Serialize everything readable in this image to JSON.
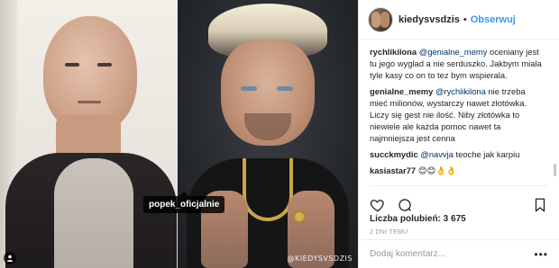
{
  "media": {
    "tag_label": "popek_oficjalnie",
    "watermark": "@KIEDYSVSDZIS"
  },
  "header": {
    "username": "kiedysvsdzis",
    "separator": "•",
    "follow_label": "Obserwuj"
  },
  "comments": [
    {
      "user": "rychlikilona",
      "mention": "@genialne_memy",
      "text": " oceniany jest tu jego wyglad a nie serduszko. Jakbym miala tyle kasy co on to tez bym wspierala."
    },
    {
      "user": "genialne_memy",
      "mention": "@rychlikilona",
      "text": " nie trzeba mieć milionów, wystarczy nawet złotówka. Liczy się gest nie ilość. Niby złotówka to niewiele ale każda pomoc nawet ta najmniejsza jest cenna"
    },
    {
      "user": "succkmydic",
      "mention": "@navvja",
      "text": " teoche jak karpiu"
    },
    {
      "user": "kasiastar77",
      "mention": "",
      "text": " 😊😊👌👌"
    }
  ],
  "actions": {
    "likes_label": "Liczba polubień: 3 675",
    "timestamp": "2 DNI TEMU"
  },
  "add_comment": {
    "placeholder": "Dodaj komentarz...",
    "more": "•••"
  },
  "icons": {
    "like": "heart-icon",
    "comment": "comment-icon",
    "save": "bookmark-icon",
    "tag": "person-tag-icon"
  },
  "colors": {
    "link": "#3897f0",
    "mention": "#003569",
    "muted": "#999999"
  }
}
